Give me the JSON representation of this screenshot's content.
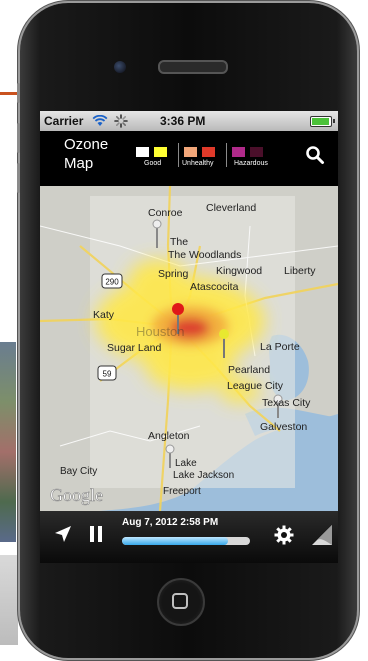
{
  "status_bar": {
    "carrier": "Carrier",
    "time": "3:36 PM"
  },
  "nav": {
    "title_line1": "Ozone",
    "title_line2": "Map",
    "legend": {
      "good_label": "Good",
      "unhealthy_label": "Unhealthy",
      "hazardous_label": "Hazardous",
      "swatches": [
        "#ffffff",
        "#ffff33",
        "#f2a679",
        "#e03a2a",
        "#b02a8a",
        "#4a0f2a"
      ]
    },
    "search_icon": "search-icon"
  },
  "map": {
    "labels": [
      "Conroe",
      "Cleverland",
      "The Woodlands",
      "Spring",
      "Kingwood",
      "Liberty",
      "Atascocita",
      "Katy",
      "Houston",
      "Sugar Land",
      "La Porte",
      "Pearland",
      "League City",
      "Texas City",
      "Galveston",
      "Angleton",
      "Lake Jackson",
      "Freeport",
      "Bay City"
    ],
    "highway_shields": [
      "290",
      "59"
    ],
    "watermark": "Google",
    "overlay_colors": {
      "low": "#ffe84a",
      "mid": "#f1a73a",
      "high": "#d8282b"
    }
  },
  "toolbar": {
    "date": "Aug 7, 2012 2:58 PM",
    "progress": 0.83,
    "location_icon": "location-arrow-icon",
    "pause_icon": "pause-icon",
    "settings_icon": "gear-icon",
    "page_curl_icon": "page-curl-icon"
  },
  "colors": {
    "accent": "#38a8ea",
    "navbar": "#000000",
    "statusbar": "#cfcfcf"
  }
}
